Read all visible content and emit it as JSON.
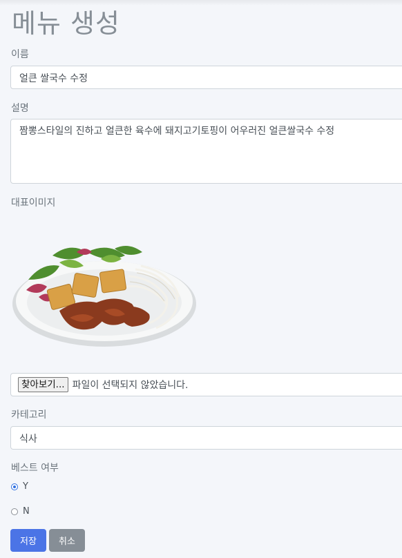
{
  "page": {
    "title": "메뉴 생성"
  },
  "form": {
    "name_label": "이름",
    "name_value": "얼큰 쌀국수 수정",
    "desc_label": "설명",
    "desc_value": "짬뽕스타일의 진하고 얼큰한 육수에 돼지고기토핑이 어우러진 얼큰쌀국수 수정",
    "image_label": "대표이미지",
    "image_icon": "dish-photo",
    "file_button": "찾아보기...",
    "file_status": "파일이 선택되지 않았습니다.",
    "category_label": "카테고리",
    "category_value": "식사",
    "best_label": "베스트 여부",
    "best_options": [
      {
        "label": "Y",
        "checked": true
      },
      {
        "label": "N",
        "checked": false
      }
    ],
    "save_label": "저장",
    "cancel_label": "취소"
  },
  "colors": {
    "primary": "#4b74e6",
    "secondary": "#868e96",
    "background": "#f4f6fa"
  }
}
